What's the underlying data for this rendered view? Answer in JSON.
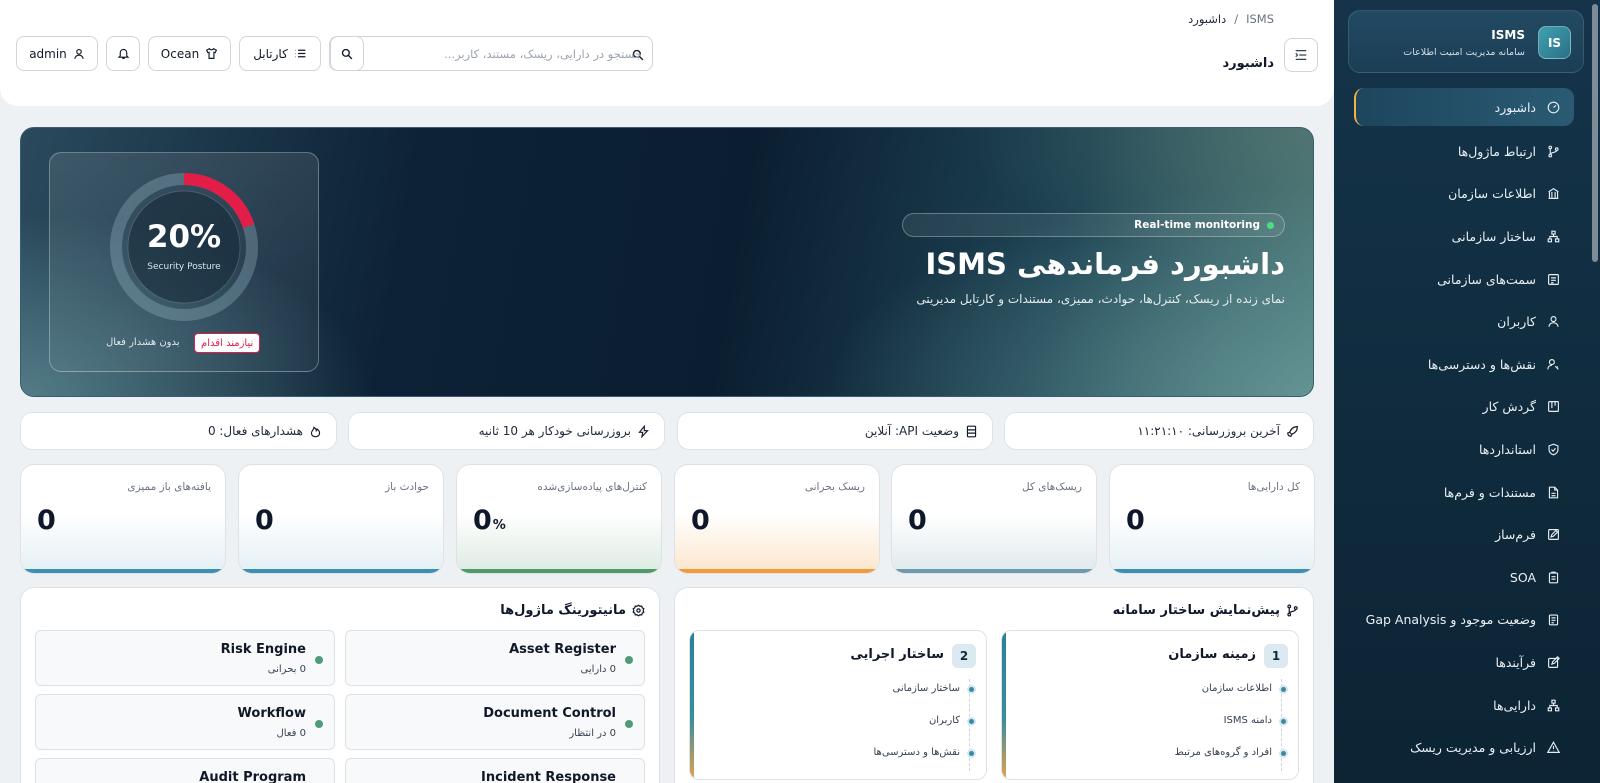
{
  "app": {
    "name": "ISMS",
    "logo": "IS",
    "subtitle": "سامانه مدیریت امنیت اطلاعات"
  },
  "sidebar": {
    "items": [
      {
        "label": "داشبورد",
        "icon": "gauge-icon",
        "active": true
      },
      {
        "label": "ارتباط ماژول‌ها",
        "icon": "git-branch-icon"
      },
      {
        "label": "اطلاعات سازمان",
        "icon": "bank-icon"
      },
      {
        "label": "ساختار سازمانی",
        "icon": "org-chart-icon"
      },
      {
        "label": "سمت‌های سازمانی",
        "icon": "id-card-icon"
      },
      {
        "label": "کاربران",
        "icon": "user-icon"
      },
      {
        "label": "نقش‌ها و دسترسی‌ها",
        "icon": "users-key-icon"
      },
      {
        "label": "گردش کار",
        "icon": "kanban-icon"
      },
      {
        "label": "استانداردها",
        "icon": "shield-check-icon"
      },
      {
        "label": "مستندات و فرم‌ها",
        "icon": "file-icon"
      },
      {
        "label": "فرم‌ساز",
        "icon": "edit-icon"
      },
      {
        "label": "SOA",
        "icon": "clipboard-icon"
      },
      {
        "label": "وضعیت موجود و Gap Analysis",
        "icon": "clipboard-list-icon"
      },
      {
        "label": "فرآیندها",
        "icon": "pencil-square-icon"
      },
      {
        "label": "دارایی‌ها",
        "icon": "sitemap-icon"
      },
      {
        "label": "ارزیابی و مدیریت ریسک",
        "icon": "warning-icon"
      }
    ]
  },
  "header": {
    "breadcrumb": [
      "ISMS",
      "داشبورد"
    ],
    "breadcrumb_sep": "/",
    "title": "داشبورد",
    "search_placeholder": "جستجو در دارایی، ریسک، مستند، کاربر...",
    "kartabl": "کارتابل",
    "theme": "Ocean",
    "user": "admin"
  },
  "hero": {
    "badge": "Real-time monitoring",
    "title": "داشبورد فرماندهی ISMS",
    "subtitle": "نمای زنده از ریسک، کنترل‌ها، حوادث، ممیزی، مستندات و کارتابل مدیریتی",
    "posture_value": "20%",
    "posture_fraction": 0.2,
    "posture_label": "Security Posture",
    "need_action": "نیازمند اقدام",
    "no_alert": "بدون هشدار فعال"
  },
  "status": {
    "last_update": "آخرین بروزرسانی: ۱۱:۲۱:۱۰",
    "api": "وضعیت API: آنلاین",
    "auto_refresh": "بروزرسانی خودکار هر 10 ثانیه",
    "active_alerts": "هشدارهای فعال: 0"
  },
  "kpis": [
    {
      "label": "کل دارایی‌ها",
      "value": "0",
      "color": "#3b8fb0"
    },
    {
      "label": "ریسک‌های کل",
      "value": "0",
      "color": "#6f99ad"
    },
    {
      "label": "ریسک بحرانی",
      "value": "0",
      "color": "#f29b38"
    },
    {
      "label": "کنترل‌های پیاده‌سازی‌شده",
      "value": "0",
      "unit": "%",
      "color": "#4f9a6a"
    },
    {
      "label": "حوادث باز",
      "value": "0",
      "color": "#3b8fb0"
    },
    {
      "label": "یافته‌های باز ممیزی",
      "value": "0",
      "color": "#3b8fb0"
    }
  ],
  "structure": {
    "title": "پیش‌نمایش ساختار سامانه",
    "columns": [
      {
        "num": "1",
        "title": "زمینه سازمان",
        "items": [
          "اطلاعات سازمان",
          "دامنه ISMS",
          "افراد و گروه‌های مرتبط"
        ]
      },
      {
        "num": "2",
        "title": "ساختار اجرایی",
        "items": [
          "ساختار سازمانی",
          "کاربران",
          "نقش‌ها و دسترسی‌ها"
        ]
      }
    ]
  },
  "modules": {
    "title": "مانیتورینگ ماژول‌ها",
    "items": [
      {
        "name": "Asset Register",
        "sub": "0 دارایی"
      },
      {
        "name": "Risk Engine",
        "sub": "0 بحرانی"
      },
      {
        "name": "Document Control",
        "sub": "0 در انتظار"
      },
      {
        "name": "Workflow",
        "sub": "0 فعال"
      },
      {
        "name": "Incident Response",
        "sub": ""
      },
      {
        "name": "Audit Program",
        "sub": ""
      }
    ]
  },
  "colors": {
    "sidebar_bg": "#15344a",
    "active_accent": "#f0b34a",
    "alert_red": "#e11d48",
    "online_green": "#4ade80"
  }
}
